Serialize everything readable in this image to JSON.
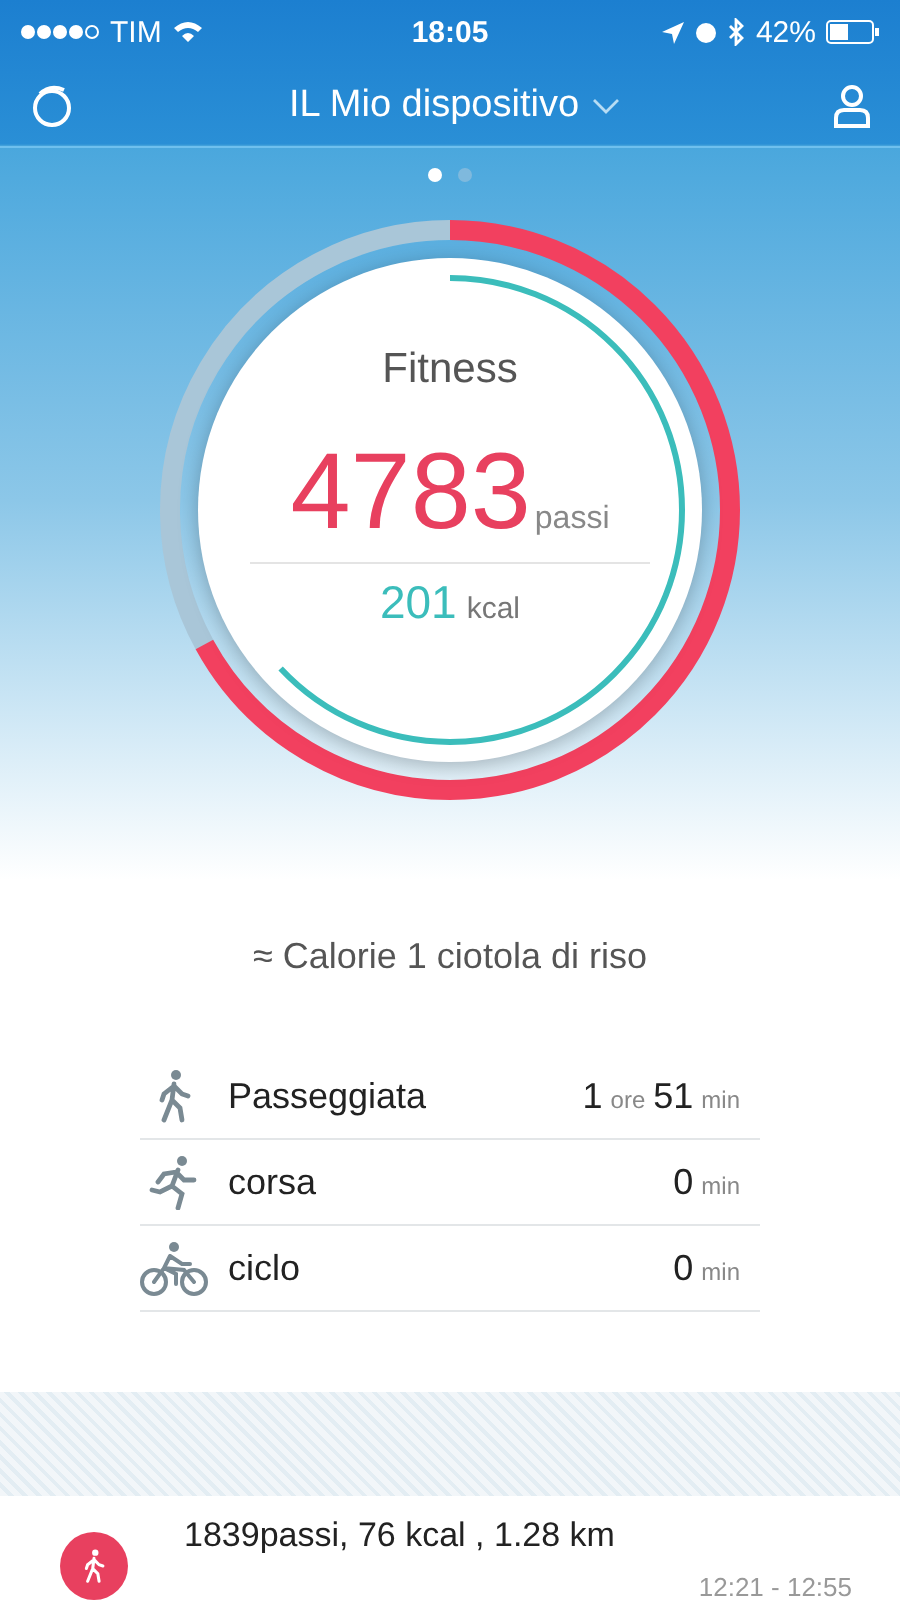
{
  "status_bar": {
    "carrier": "TIM",
    "time": "18:05",
    "battery": "42%"
  },
  "nav": {
    "title": "IL Mio dispositivo"
  },
  "pager": [
    {
      "selected": true
    },
    {
      "selected": false
    }
  ],
  "ring": {
    "title": "Fitness",
    "steps": "4783",
    "steps_unit": "passi",
    "kcal": "201",
    "kcal_unit": "kcal",
    "steps_progress": {
      "level": 0.67
    },
    "kcal_progress": {
      "level": 0.63
    }
  },
  "calorie_note": "≈ Calorie 1 ciotola di riso",
  "activities": [
    {
      "kind": "walk",
      "name": "Passeggiata",
      "value": [
        {
          "kind": "num",
          "text": "1"
        },
        {
          "kind": "unit",
          "text": "ore"
        },
        {
          "kind": "num",
          "text": "51"
        },
        {
          "kind": "unit",
          "text": "min"
        }
      ]
    },
    {
      "kind": "run",
      "name": "corsa",
      "value": [
        {
          "kind": "num",
          "text": "0"
        },
        {
          "kind": "unit",
          "text": "min"
        }
      ]
    },
    {
      "kind": "bike",
      "name": "ciclo",
      "value": [
        {
          "kind": "num",
          "text": "0"
        },
        {
          "kind": "unit",
          "text": "min"
        }
      ]
    }
  ],
  "record": {
    "summary": "1839passi, 76 kcal , 1.28 km",
    "time": "12:21 - 12:55"
  }
}
